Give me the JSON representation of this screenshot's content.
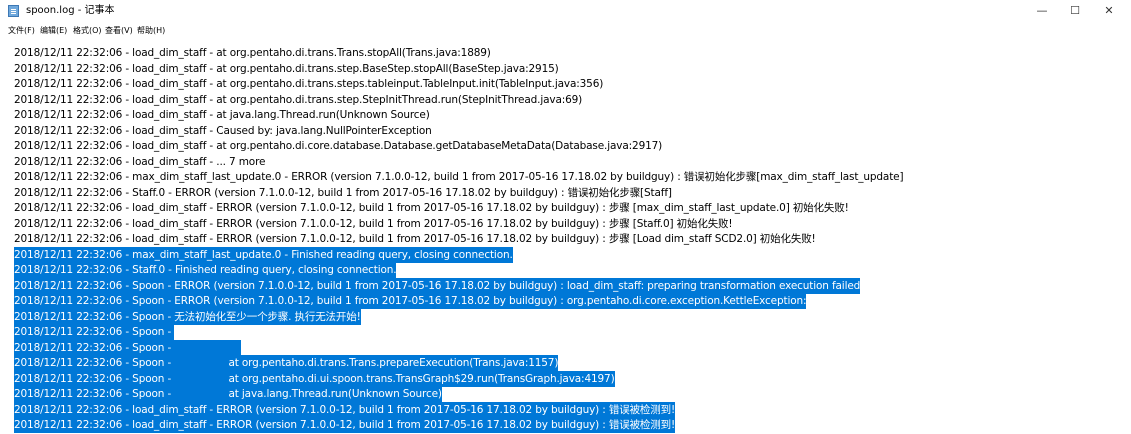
{
  "window": {
    "title": "spoon.log - 记事本",
    "minimize_glyph": "—",
    "maximize_glyph": "☐",
    "close_glyph": "✕"
  },
  "menu": {
    "items": [
      "文件(F)",
      "编辑(E)",
      "格式(O)",
      "查看(V)",
      "帮助(H)"
    ]
  },
  "colors": {
    "selection_bg": "#0078d7",
    "selection_text": "#ffffff"
  },
  "editor": {
    "lines": [
      {
        "text": "2018/12/11 22:32:06 - load_dim_staff - at org.pentaho.di.trans.Trans.stopAll(Trans.java:1889)",
        "selected": false
      },
      {
        "text": "2018/12/11 22:32:06 - load_dim_staff - at org.pentaho.di.trans.step.BaseStep.stopAll(BaseStep.java:2915)",
        "selected": false
      },
      {
        "text": "2018/12/11 22:32:06 - load_dim_staff - at org.pentaho.di.trans.steps.tableinput.TableInput.init(TableInput.java:356)",
        "selected": false
      },
      {
        "text": "2018/12/11 22:32:06 - load_dim_staff - at org.pentaho.di.trans.step.StepInitThread.run(StepInitThread.java:69)",
        "selected": false
      },
      {
        "text": "2018/12/11 22:32:06 - load_dim_staff - at java.lang.Thread.run(Unknown Source)",
        "selected": false
      },
      {
        "text": "2018/12/11 22:32:06 - load_dim_staff - Caused by: java.lang.NullPointerException",
        "selected": false
      },
      {
        "text": "2018/12/11 22:32:06 - load_dim_staff - at org.pentaho.di.core.database.Database.getDatabaseMetaData(Database.java:2917)",
        "selected": false
      },
      {
        "text": "2018/12/11 22:32:06 - load_dim_staff - ... 7 more",
        "selected": false
      },
      {
        "text": "2018/12/11 22:32:06 - max_dim_staff_last_update.0 - ERROR (version 7.1.0.0-12, build 1 from 2017-05-16 17.18.02 by buildguy) : 错误初始化步骤[max_dim_staff_last_update]",
        "selected": false
      },
      {
        "text": "2018/12/11 22:32:06 - Staff.0 - ERROR (version 7.1.0.0-12, build 1 from 2017-05-16 17.18.02 by buildguy) : 错误初始化步骤[Staff]",
        "selected": false
      },
      {
        "text": "2018/12/11 22:32:06 - load_dim_staff - ERROR (version 7.1.0.0-12, build 1 from 2017-05-16 17.18.02 by buildguy) : 步骤 [max_dim_staff_last_update.0] 初始化失败!",
        "selected": false
      },
      {
        "text": "2018/12/11 22:32:06 - load_dim_staff - ERROR (version 7.1.0.0-12, build 1 from 2017-05-16 17.18.02 by buildguy) : 步骤 [Staff.0] 初始化失败!",
        "selected": false
      },
      {
        "text": "2018/12/11 22:32:06 - load_dim_staff - ERROR (version 7.1.0.0-12, build 1 from 2017-05-16 17.18.02 by buildguy) : 步骤 [Load dim_staff SCD2.0] 初始化失败!",
        "selected": false
      },
      {
        "text": "2018/12/11 22:32:06 - max_dim_staff_last_update.0 - Finished reading query, closing connection.",
        "selected": true
      },
      {
        "text": "2018/12/11 22:32:06 - Staff.0 - Finished reading query, closing connection.",
        "selected": true
      },
      {
        "text": "2018/12/11 22:32:06 - Spoon - ERROR (version 7.1.0.0-12, build 1 from 2017-05-16 17.18.02 by buildguy) : load_dim_staff: preparing transformation execution failed",
        "selected": true
      },
      {
        "text": "2018/12/11 22:32:06 - Spoon - ERROR (version 7.1.0.0-12, build 1 from 2017-05-16 17.18.02 by buildguy) : org.pentaho.di.core.exception.KettleException:",
        "selected": true
      },
      {
        "text": "2018/12/11 22:32:06 - Spoon - 无法初始化至少一个步骤. 执行无法开始!",
        "selected": true
      },
      {
        "text": "2018/12/11 22:32:06 - Spoon - ",
        "selected": true
      },
      {
        "text": "2018/12/11 22:32:06 - Spoon -                      ",
        "selected": true
      },
      {
        "text": "2018/12/11 22:32:06 - Spoon -                  at org.pentaho.di.trans.Trans.prepareExecution(Trans.java:1157)",
        "selected": true
      },
      {
        "text": "2018/12/11 22:32:06 - Spoon -                  at org.pentaho.di.ui.spoon.trans.TransGraph$29.run(TransGraph.java:4197)",
        "selected": true
      },
      {
        "text": "2018/12/11 22:32:06 - Spoon -                  at java.lang.Thread.run(Unknown Source)",
        "selected": true
      },
      {
        "text": "2018/12/11 22:32:06 - load_dim_staff - ERROR (version 7.1.0.0-12, build 1 from 2017-05-16 17.18.02 by buildguy) : 错误被检测到!",
        "selected": true
      },
      {
        "text": "2018/12/11 22:32:06 - load_dim_staff - ERROR (version 7.1.0.0-12, build 1 from 2017-05-16 17.18.02 by buildguy) : 错误被检测到!",
        "selected": true
      }
    ]
  }
}
